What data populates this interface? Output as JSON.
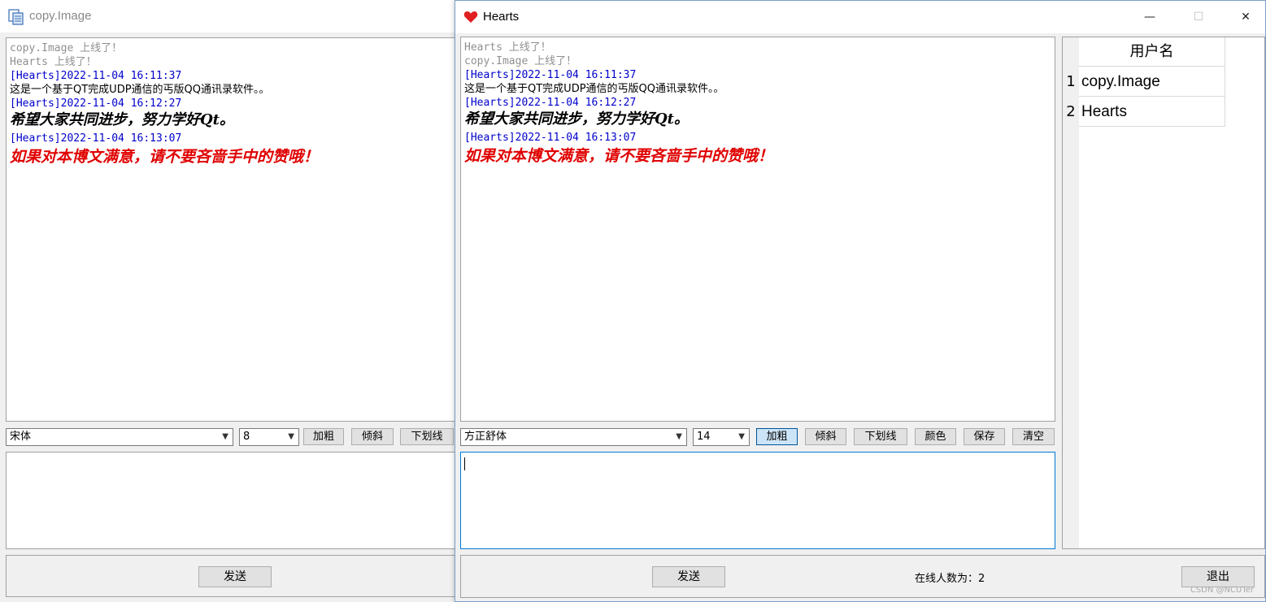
{
  "back_window": {
    "title": "copy.Image",
    "icon": "copy-document-icon",
    "messages": [
      {
        "type": "status",
        "text": "copy.Image 上线了！"
      },
      {
        "type": "status",
        "text": "Hearts 上线了！"
      },
      {
        "type": "header",
        "text": "[Hearts]2022-11-04 16:11:37"
      },
      {
        "type": "body",
        "text": "这是一个基于QT完成UDP通信的丐版QQ通讯录软件。。"
      },
      {
        "type": "header",
        "text": "[Hearts]2022-11-04 16:12:27"
      },
      {
        "type": "bold",
        "text": "希望大家共同进步，努力学好Qt。"
      },
      {
        "type": "header",
        "text": "[Hearts]2022-11-04 16:13:07"
      },
      {
        "type": "red",
        "text": "如果对本博文满意，请不要吝啬手中的赞哦！"
      }
    ],
    "font_combo": "宋体",
    "size_combo": "8",
    "bold_button": "加粗",
    "italic_button": "倾斜",
    "underline_button": "下划线",
    "send_button": "发送"
  },
  "front_window": {
    "title": "Hearts",
    "icon": "heart-icon",
    "window_controls": {
      "minimize": "—",
      "maximize": "☐",
      "close": "✕"
    },
    "messages": [
      {
        "type": "status",
        "text": "Hearts 上线了！"
      },
      {
        "type": "status",
        "text": "copy.Image 上线了！"
      },
      {
        "type": "header",
        "text": "[Hearts]2022-11-04 16:11:37"
      },
      {
        "type": "body",
        "text": "这是一个基于QT完成UDP通信的丐版QQ通讯录软件。。"
      },
      {
        "type": "header",
        "text": "[Hearts]2022-11-04 16:12:27"
      },
      {
        "type": "bold",
        "text": "希望大家共同进步，努力学好Qt。"
      },
      {
        "type": "header",
        "text": "[Hearts]2022-11-04 16:13:07"
      },
      {
        "type": "red",
        "text": "如果对本博文满意，请不要吝啬手中的赞哦！"
      }
    ],
    "font_combo": "方正舒体",
    "size_combo": "14",
    "bold_button": "加粗",
    "italic_button": "倾斜",
    "underline_button": "下划线",
    "color_button": "颜色",
    "save_button": "保存",
    "clear_button": "清空",
    "send_button": "发送",
    "online_count": "在线人数为：2",
    "exit_button": "退出",
    "user_table": {
      "header": "用户名",
      "rows": [
        {
          "num": "1",
          "name": "copy.Image"
        },
        {
          "num": "2",
          "name": "Hearts"
        }
      ]
    }
  },
  "watermark": "CSDN @NCUTer",
  "colors": {
    "status": "#909090",
    "header": "#0000cc",
    "red_text": "#e00000",
    "heart": "#e02020"
  }
}
